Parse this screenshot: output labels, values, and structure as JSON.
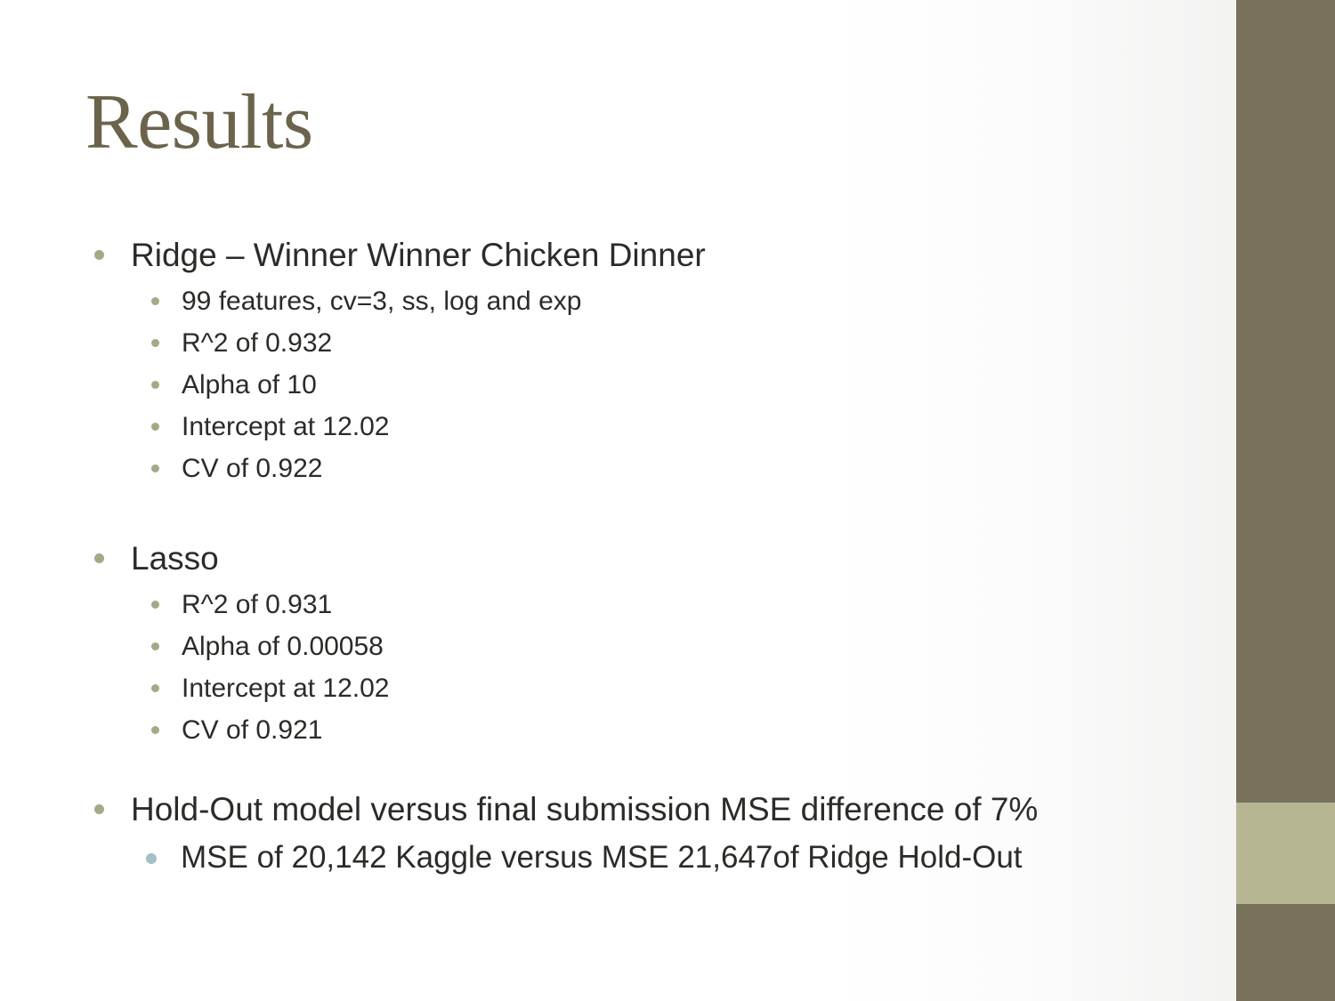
{
  "slide": {
    "title": "Results",
    "theme": {
      "title_color": "#6B634C",
      "body_text_color": "#2B2B28",
      "bar_dark": "#79725B",
      "bar_accent": "#B7B692",
      "bullet_olive": "#A6A886",
      "bullet_blue": "#A3C0C5",
      "background": "#FFFFFF"
    },
    "content": [
      {
        "level": 1,
        "text": "Ridge – Winner Winner Chicken Dinner"
      },
      {
        "level": 2,
        "text": "99 features, cv=3, ss, log and exp"
      },
      {
        "level": 2,
        "text": "R^2 of 0.932"
      },
      {
        "level": 2,
        "text": "Alpha of 10"
      },
      {
        "level": 2,
        "text": "Intercept at 12.02"
      },
      {
        "level": 2,
        "text": "CV of 0.922"
      },
      {
        "level": 1,
        "text": "Lasso"
      },
      {
        "level": 2,
        "text": "R^2 of 0.931"
      },
      {
        "level": 2,
        "text": "Alpha of 0.00058"
      },
      {
        "level": 2,
        "text": "Intercept at 12.02"
      },
      {
        "level": 2,
        "text": "CV of 0.921"
      },
      {
        "level": 1,
        "text": "Hold-Out model versus final submission MSE difference of 7%"
      },
      {
        "level": 2,
        "text": "MSE of 20,142 Kaggle versus MSE 21,647of Ridge Hold-Out"
      }
    ]
  }
}
